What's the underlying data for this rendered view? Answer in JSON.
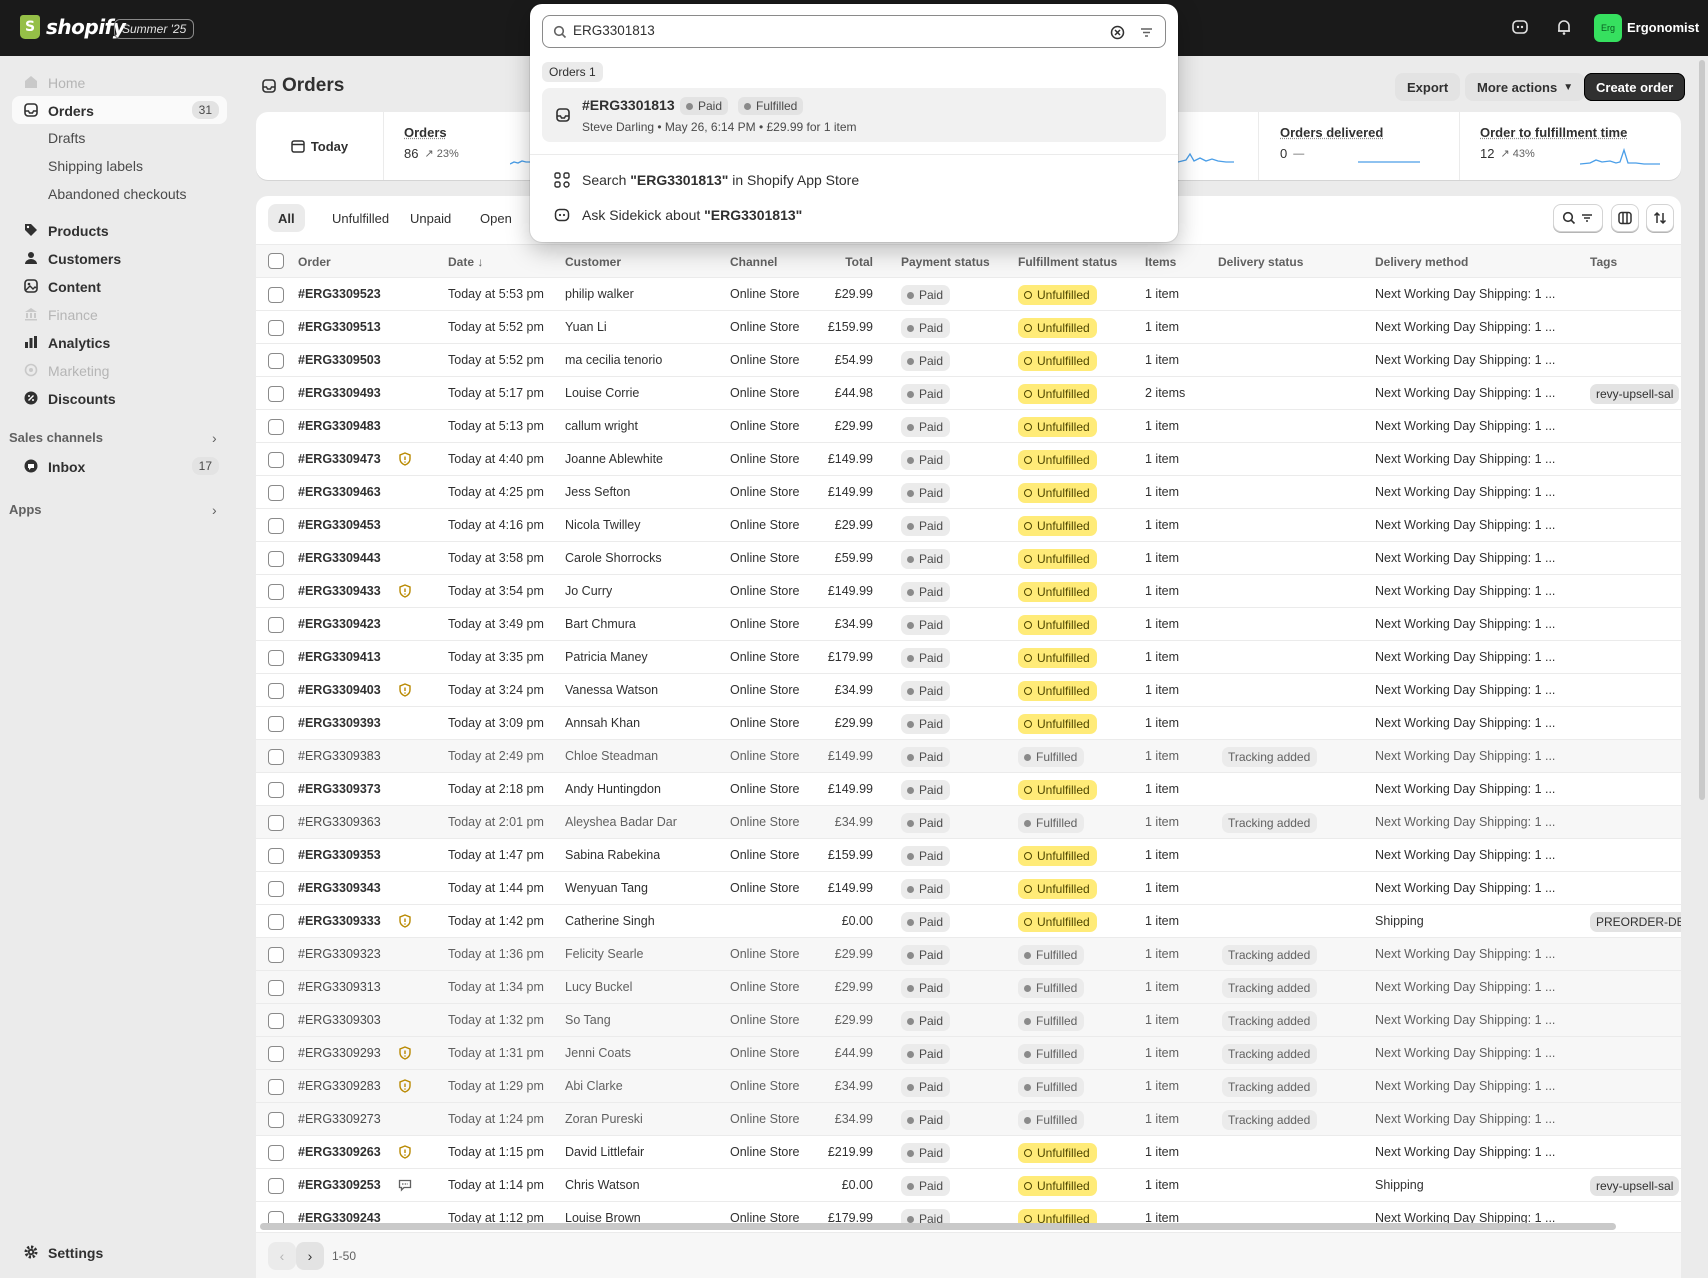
{
  "topbar": {
    "brand": "shopify",
    "edition": "Summer '25",
    "store_initials": "Erg",
    "store_name": "Ergonomist"
  },
  "sidebar": {
    "items": [
      {
        "label": "Home",
        "disabled": true,
        "icon": "home-icon"
      },
      {
        "label": "Orders",
        "count": "31",
        "active": true,
        "icon": "orders-icon"
      },
      {
        "label": "Products",
        "icon": "tag-icon"
      },
      {
        "label": "Customers",
        "icon": "person-icon"
      },
      {
        "label": "Content",
        "icon": "content-icon"
      },
      {
        "label": "Finance",
        "disabled": true,
        "icon": "bank-icon"
      },
      {
        "label": "Analytics",
        "icon": "chart-icon"
      },
      {
        "label": "Marketing",
        "disabled": true,
        "icon": "target-icon"
      },
      {
        "label": "Discounts",
        "icon": "discount-icon"
      }
    ],
    "orders_sub": [
      "Drafts",
      "Shipping labels",
      "Abandoned checkouts"
    ],
    "sales_channels_label": "Sales channels",
    "inbox_label": "Inbox",
    "inbox_count": "17",
    "apps_label": "Apps",
    "settings_label": "Settings"
  },
  "page": {
    "title": "Orders",
    "export_label": "Export",
    "more_actions_label": "More actions",
    "create_order_label": "Create order"
  },
  "metrics": {
    "today_label": "Today",
    "orders_label": "Orders",
    "orders_value": "86",
    "orders_change": "23%",
    "delivered_label": "Orders delivered",
    "delivered_value": "0",
    "delivered_change": "—",
    "fulfillment_label": "Order to fulfillment time",
    "fulfillment_value": "12",
    "fulfillment_change": "43%"
  },
  "filters": {
    "tabs": [
      "All",
      "Unfulfilled",
      "Unpaid",
      "Open"
    ]
  },
  "table": {
    "headers": {
      "order": "Order",
      "date": "Date",
      "customer": "Customer",
      "channel": "Channel",
      "total": "Total",
      "payment": "Payment status",
      "fulfillment": "Fulfillment status",
      "items": "Items",
      "delivery_status": "Delivery status",
      "delivery_method": "Delivery method",
      "tags": "Tags"
    },
    "rows": [
      {
        "order": "#ERG3309523",
        "date": "Today at 5:53 pm",
        "customer": "philip walker",
        "channel": "Online Store",
        "total": "£29.99",
        "payment": "Paid",
        "fulfillment": "Unfulfilled",
        "items": "1 item",
        "delivery_status": "",
        "delivery_method": "Next Working Day Shipping: 1 ...",
        "tags": "",
        "flag": ""
      },
      {
        "order": "#ERG3309513",
        "date": "Today at 5:52 pm",
        "customer": "Yuan Li",
        "channel": "Online Store",
        "total": "£159.99",
        "payment": "Paid",
        "fulfillment": "Unfulfilled",
        "items": "1 item",
        "delivery_status": "",
        "delivery_method": "Next Working Day Shipping: 1 ...",
        "tags": "",
        "flag": ""
      },
      {
        "order": "#ERG3309503",
        "date": "Today at 5:52 pm",
        "customer": "ma cecilia tenorio",
        "channel": "Online Store",
        "total": "£54.99",
        "payment": "Paid",
        "fulfillment": "Unfulfilled",
        "items": "1 item",
        "delivery_status": "",
        "delivery_method": "Next Working Day Shipping: 1 ...",
        "tags": "",
        "flag": ""
      },
      {
        "order": "#ERG3309493",
        "date": "Today at 5:17 pm",
        "customer": "Louise Corrie",
        "channel": "Online Store",
        "total": "£44.98",
        "payment": "Paid",
        "fulfillment": "Unfulfilled",
        "items": "2 items",
        "delivery_status": "",
        "delivery_method": "Next Working Day Shipping: 1 ...",
        "tags": "revy-upsell-sal",
        "flag": ""
      },
      {
        "order": "#ERG3309483",
        "date": "Today at 5:13 pm",
        "customer": "callum wright",
        "channel": "Online Store",
        "total": "£29.99",
        "payment": "Paid",
        "fulfillment": "Unfulfilled",
        "items": "1 item",
        "delivery_status": "",
        "delivery_method": "Next Working Day Shipping: 1 ...",
        "tags": "",
        "flag": ""
      },
      {
        "order": "#ERG3309473",
        "date": "Today at 4:40 pm",
        "customer": "Joanne Ablewhite",
        "channel": "Online Store",
        "total": "£149.99",
        "payment": "Paid",
        "fulfillment": "Unfulfilled",
        "items": "1 item",
        "delivery_status": "",
        "delivery_method": "Next Working Day Shipping: 1 ...",
        "tags": "",
        "flag": "risk"
      },
      {
        "order": "#ERG3309463",
        "date": "Today at 4:25 pm",
        "customer": "Jess Sefton",
        "channel": "Online Store",
        "total": "£149.99",
        "payment": "Paid",
        "fulfillment": "Unfulfilled",
        "items": "1 item",
        "delivery_status": "",
        "delivery_method": "Next Working Day Shipping: 1 ...",
        "tags": "",
        "flag": ""
      },
      {
        "order": "#ERG3309453",
        "date": "Today at 4:16 pm",
        "customer": "Nicola Twilley",
        "channel": "Online Store",
        "total": "£29.99",
        "payment": "Paid",
        "fulfillment": "Unfulfilled",
        "items": "1 item",
        "delivery_status": "",
        "delivery_method": "Next Working Day Shipping: 1 ...",
        "tags": "",
        "flag": ""
      },
      {
        "order": "#ERG3309443",
        "date": "Today at 3:58 pm",
        "customer": "Carole Shorrocks",
        "channel": "Online Store",
        "total": "£59.99",
        "payment": "Paid",
        "fulfillment": "Unfulfilled",
        "items": "1 item",
        "delivery_status": "",
        "delivery_method": "Next Working Day Shipping: 1 ...",
        "tags": "",
        "flag": ""
      },
      {
        "order": "#ERG3309433",
        "date": "Today at 3:54 pm",
        "customer": "Jo Curry",
        "channel": "Online Store",
        "total": "£149.99",
        "payment": "Paid",
        "fulfillment": "Unfulfilled",
        "items": "1 item",
        "delivery_status": "",
        "delivery_method": "Next Working Day Shipping: 1 ...",
        "tags": "",
        "flag": "risk"
      },
      {
        "order": "#ERG3309423",
        "date": "Today at 3:49 pm",
        "customer": "Bart Chmura",
        "channel": "Online Store",
        "total": "£34.99",
        "payment": "Paid",
        "fulfillment": "Unfulfilled",
        "items": "1 item",
        "delivery_status": "",
        "delivery_method": "Next Working Day Shipping: 1 ...",
        "tags": "",
        "flag": ""
      },
      {
        "order": "#ERG3309413",
        "date": "Today at 3:35 pm",
        "customer": "Patricia Maney",
        "channel": "Online Store",
        "total": "£179.99",
        "payment": "Paid",
        "fulfillment": "Unfulfilled",
        "items": "1 item",
        "delivery_status": "",
        "delivery_method": "Next Working Day Shipping: 1 ...",
        "tags": "",
        "flag": ""
      },
      {
        "order": "#ERG3309403",
        "date": "Today at 3:24 pm",
        "customer": "Vanessa Watson",
        "channel": "Online Store",
        "total": "£34.99",
        "payment": "Paid",
        "fulfillment": "Unfulfilled",
        "items": "1 item",
        "delivery_status": "",
        "delivery_method": "Next Working Day Shipping: 1 ...",
        "tags": "",
        "flag": "risk"
      },
      {
        "order": "#ERG3309393",
        "date": "Today at 3:09 pm",
        "customer": "Annsah Khan",
        "channel": "Online Store",
        "total": "£29.99",
        "payment": "Paid",
        "fulfillment": "Unfulfilled",
        "items": "1 item",
        "delivery_status": "",
        "delivery_method": "Next Working Day Shipping: 1 ...",
        "tags": "",
        "flag": ""
      },
      {
        "order": "#ERG3309383",
        "date": "Today at 2:49 pm",
        "customer": "Chloe Steadman",
        "channel": "Online Store",
        "total": "£149.99",
        "payment": "Paid",
        "fulfillment": "Fulfilled",
        "items": "1 item",
        "delivery_status": "Tracking added",
        "delivery_method": "Next Working Day Shipping: 1 ...",
        "tags": "",
        "flag": ""
      },
      {
        "order": "#ERG3309373",
        "date": "Today at 2:18 pm",
        "customer": "Andy Huntingdon",
        "channel": "Online Store",
        "total": "£149.99",
        "payment": "Paid",
        "fulfillment": "Unfulfilled",
        "items": "1 item",
        "delivery_status": "",
        "delivery_method": "Next Working Day Shipping: 1 ...",
        "tags": "",
        "flag": ""
      },
      {
        "order": "#ERG3309363",
        "date": "Today at 2:01 pm",
        "customer": "Aleyshea Badar Dar",
        "channel": "Online Store",
        "total": "£34.99",
        "payment": "Paid",
        "fulfillment": "Fulfilled",
        "items": "1 item",
        "delivery_status": "Tracking added",
        "delivery_method": "Next Working Day Shipping: 1 ...",
        "tags": "",
        "flag": ""
      },
      {
        "order": "#ERG3309353",
        "date": "Today at 1:47 pm",
        "customer": "Sabina Rabekina",
        "channel": "Online Store",
        "total": "£159.99",
        "payment": "Paid",
        "fulfillment": "Unfulfilled",
        "items": "1 item",
        "delivery_status": "",
        "delivery_method": "Next Working Day Shipping: 1 ...",
        "tags": "",
        "flag": ""
      },
      {
        "order": "#ERG3309343",
        "date": "Today at 1:44 pm",
        "customer": "Wenyuan Tang",
        "channel": "Online Store",
        "total": "£149.99",
        "payment": "Paid",
        "fulfillment": "Unfulfilled",
        "items": "1 item",
        "delivery_status": "",
        "delivery_method": "Next Working Day Shipping: 1 ...",
        "tags": "",
        "flag": ""
      },
      {
        "order": "#ERG3309333",
        "date": "Today at 1:42 pm",
        "customer": "Catherine Singh",
        "channel": "",
        "total": "£0.00",
        "payment": "Paid",
        "fulfillment": "Unfulfilled",
        "items": "1 item",
        "delivery_status": "",
        "delivery_method": "Shipping",
        "tags": "PREORDER-DE",
        "flag": "risk"
      },
      {
        "order": "#ERG3309323",
        "date": "Today at 1:36 pm",
        "customer": "Felicity Searle",
        "channel": "Online Store",
        "total": "£29.99",
        "payment": "Paid",
        "fulfillment": "Fulfilled",
        "items": "1 item",
        "delivery_status": "Tracking added",
        "delivery_method": "Next Working Day Shipping: 1 ...",
        "tags": "",
        "flag": ""
      },
      {
        "order": "#ERG3309313",
        "date": "Today at 1:34 pm",
        "customer": "Lucy Buckel",
        "channel": "Online Store",
        "total": "£29.99",
        "payment": "Paid",
        "fulfillment": "Fulfilled",
        "items": "1 item",
        "delivery_status": "Tracking added",
        "delivery_method": "Next Working Day Shipping: 1 ...",
        "tags": "",
        "flag": ""
      },
      {
        "order": "#ERG3309303",
        "date": "Today at 1:32 pm",
        "customer": "So Tang",
        "channel": "Online Store",
        "total": "£29.99",
        "payment": "Paid",
        "fulfillment": "Fulfilled",
        "items": "1 item",
        "delivery_status": "Tracking added",
        "delivery_method": "Next Working Day Shipping: 1 ...",
        "tags": "",
        "flag": ""
      },
      {
        "order": "#ERG3309293",
        "date": "Today at 1:31 pm",
        "customer": "Jenni Coats",
        "channel": "Online Store",
        "total": "£44.99",
        "payment": "Paid",
        "fulfillment": "Fulfilled",
        "items": "1 item",
        "delivery_status": "Tracking added",
        "delivery_method": "Next Working Day Shipping: 1 ...",
        "tags": "",
        "flag": "risk"
      },
      {
        "order": "#ERG3309283",
        "date": "Today at 1:29 pm",
        "customer": "Abi Clarke",
        "channel": "Online Store",
        "total": "£34.99",
        "payment": "Paid",
        "fulfillment": "Fulfilled",
        "items": "1 item",
        "delivery_status": "Tracking added",
        "delivery_method": "Next Working Day Shipping: 1 ...",
        "tags": "",
        "flag": "risk"
      },
      {
        "order": "#ERG3309273",
        "date": "Today at 1:24 pm",
        "customer": "Zoran Pureski",
        "channel": "Online Store",
        "total": "£34.99",
        "payment": "Paid",
        "fulfillment": "Fulfilled",
        "items": "1 item",
        "delivery_status": "Tracking added",
        "delivery_method": "Next Working Day Shipping: 1 ...",
        "tags": "",
        "flag": ""
      },
      {
        "order": "#ERG3309263",
        "date": "Today at 1:15 pm",
        "customer": "David Littlefair",
        "channel": "Online Store",
        "total": "£219.99",
        "payment": "Paid",
        "fulfillment": "Unfulfilled",
        "items": "1 item",
        "delivery_status": "",
        "delivery_method": "Next Working Day Shipping: 1 ...",
        "tags": "",
        "flag": "risk"
      },
      {
        "order": "#ERG3309253",
        "date": "Today at 1:14 pm",
        "customer": "Chris Watson",
        "channel": "",
        "total": "£0.00",
        "payment": "Paid",
        "fulfillment": "Unfulfilled",
        "items": "1 item",
        "delivery_status": "",
        "delivery_method": "Shipping",
        "tags": "revy-upsell-sal",
        "flag": "note"
      },
      {
        "order": "#ERG3309243",
        "date": "Today at 1:12 pm",
        "customer": "Louise Brown",
        "channel": "Online Store",
        "total": "£179.99",
        "payment": "Paid",
        "fulfillment": "Unfulfilled",
        "items": "1 item",
        "delivery_status": "",
        "delivery_method": "Next Working Day Shipping: 1 ...",
        "tags": "",
        "flag": ""
      }
    ]
  },
  "pagination": {
    "range": "1-50"
  },
  "search": {
    "query": "ERG3301813",
    "orders_pill": "Orders 1",
    "result_title": "#ERG3301813",
    "result_payment": "Paid",
    "result_fulfillment": "Fulfilled",
    "result_subtitle": "Steve Darling • May 26, 6:14 PM • £29.99 for 1 item",
    "appstore_prefix": "Search ",
    "appstore_query": "\"ERG3301813\"",
    "appstore_suffix": " in Shopify App Store",
    "sidekick_prefix": "Ask Sidekick about ",
    "sidekick_query": "\"ERG3301813\""
  },
  "colors": {
    "topbar": "#1a1a1a",
    "unfulfilled_badge": "#ffeb78",
    "risk_flag": "#b98900",
    "primary_button": "#303030"
  }
}
